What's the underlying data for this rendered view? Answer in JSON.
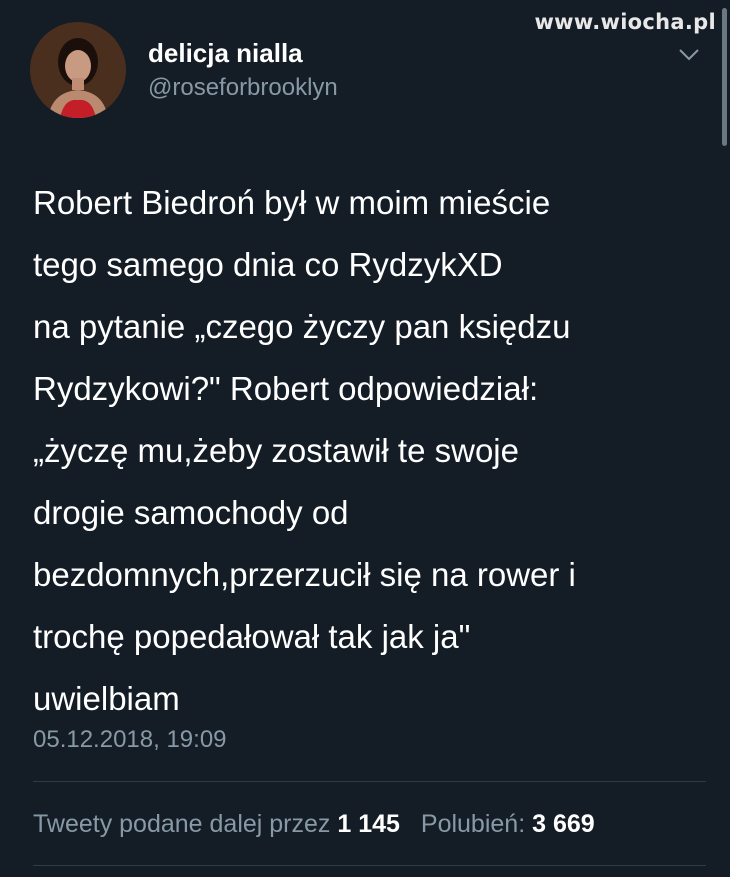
{
  "watermark": "www.wiocha.pl",
  "user": {
    "name": "delicja nialla",
    "handle": "@roseforbrooklyn"
  },
  "tweet": {
    "lines": [
      "Robert Biedroń był w moim mieście",
      "tego samego dnia co RydzykXD",
      "na pytanie „czego życzy pan księdzu",
      "Rydzykowi?\" Robert odpowiedział:",
      "„życzę mu,żeby zostawił te swoje",
      "drogie samochody od",
      "bezdomnych,przerzucił się na rower i",
      "trochę popedałował tak jak ja\"",
      "uwielbiam"
    ],
    "timestamp": "05.12.2018, 19:09"
  },
  "stats": {
    "retweets_label": "Tweety podane dalej przez",
    "retweets_count": "1 145",
    "likes_label": "Polubień:",
    "likes_count": "3 669"
  },
  "icons": {
    "menu": "chevron-down-icon"
  },
  "colors": {
    "background": "#141d26",
    "text_primary": "#ffffff",
    "text_secondary": "#8899a6",
    "divider": "#2f3b47"
  }
}
